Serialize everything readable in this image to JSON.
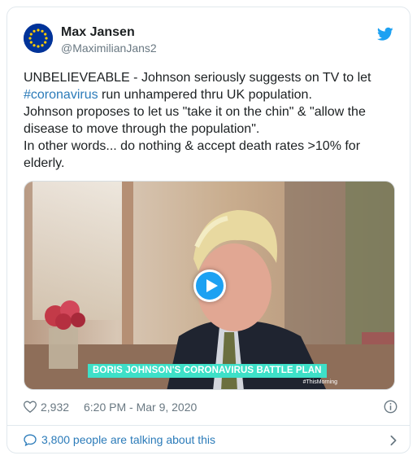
{
  "author": {
    "name": "Max Jansen",
    "handle": "@MaximilianJans2",
    "avatar_icon": "eu-flag-icon"
  },
  "tweet": {
    "lines": [
      "UNBELIEVEABLE - Johnson seriously suggests on TV to let",
      " run unhampered thru UK population.",
      "Johnson proposes to let us \"take it on the chin\" & \"allow the",
      "disease to move through the population\".",
      "In other words... do nothing & accept death rates >10% for",
      "elderly."
    ],
    "hashtag": "#coronavirus"
  },
  "media": {
    "chyron": "BORIS JOHNSON'S CORONAVIRUS BATTLE PLAN",
    "tag": "#ThisMorning",
    "play_icon": "play-icon"
  },
  "meta": {
    "likes": "2,932",
    "timestamp": "6:20 PM - Mar 9, 2020"
  },
  "footer": {
    "talking": "3,800 people are talking about this"
  },
  "colors": {
    "link": "#2b7bb9",
    "twitter_blue": "#1da1f2",
    "muted": "#697882",
    "border": "#e1e8ed"
  }
}
